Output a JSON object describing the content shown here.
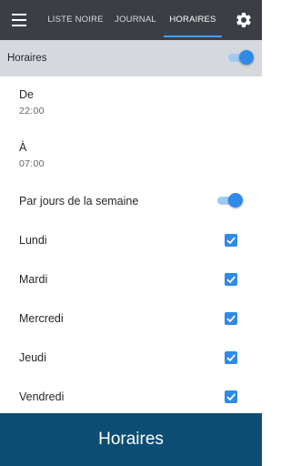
{
  "header": {
    "tabs": [
      {
        "label": "LISTE NOIRE"
      },
      {
        "label": "JOURNAL"
      },
      {
        "label": "HORAIRES",
        "active": true
      }
    ],
    "menu_icon": "hamburger-menu-icon",
    "settings_icon": "gear-icon"
  },
  "section": {
    "label": "Horaires",
    "toggle_on": true
  },
  "from": {
    "label": "De",
    "time": "22:00"
  },
  "to": {
    "label": "À",
    "time": "07:00"
  },
  "by_weekday": {
    "label": "Par jours de la semaine",
    "toggle_on": true
  },
  "days": [
    {
      "label": "Lundi",
      "checked": true
    },
    {
      "label": "Mardi",
      "checked": true
    },
    {
      "label": "Mercredi",
      "checked": true
    },
    {
      "label": "Jeudi",
      "checked": true
    },
    {
      "label": "Vendredi",
      "checked": true
    }
  ],
  "footer": {
    "title": "Horaires"
  },
  "colors": {
    "topbar": "#3b3e44",
    "accent": "#2f8ae8",
    "section_bg": "#d5d8dc",
    "footer_bg": "#0d4d73"
  }
}
